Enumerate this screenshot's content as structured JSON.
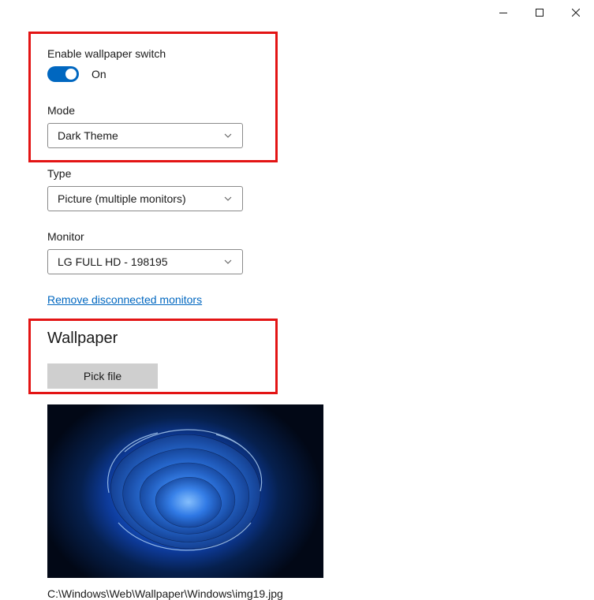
{
  "titlebar": {
    "minimize": "—",
    "maximize": "☐",
    "close": "✕"
  },
  "enable_switch": {
    "label": "Enable wallpaper switch",
    "state_label": "On",
    "on": true
  },
  "mode": {
    "label": "Mode",
    "value": "Dark Theme"
  },
  "type": {
    "label": "Type",
    "value": "Picture (multiple monitors)"
  },
  "monitor": {
    "label": "Monitor",
    "value": "LG FULL HD - 198195"
  },
  "remove_link": "Remove disconnected monitors",
  "wallpaper": {
    "title": "Wallpaper",
    "pick_button": "Pick file",
    "path": "C:\\Windows\\Web\\Wallpaper\\Windows\\img19.jpg"
  }
}
